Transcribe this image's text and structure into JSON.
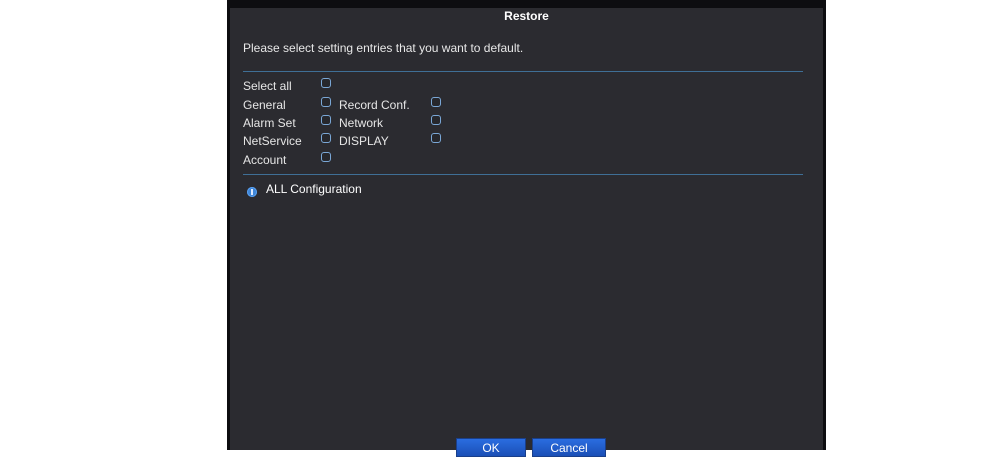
{
  "dialog": {
    "title": "Restore",
    "prompt": "Please select setting entries that you want to default.",
    "options": {
      "select_all": "Select all",
      "general": "General",
      "record_conf": "Record Conf.",
      "alarm_set": "Alarm Set",
      "network": "Network",
      "netservice": "NetService",
      "display": "DISPLAY",
      "account": "Account"
    },
    "info_text": "ALL Configuration",
    "buttons": {
      "ok": "OK",
      "cancel": "Cancel"
    },
    "colors": {
      "background": "#2b2b30",
      "accent": "#2a6de0",
      "divider": "#3f6f96"
    }
  }
}
